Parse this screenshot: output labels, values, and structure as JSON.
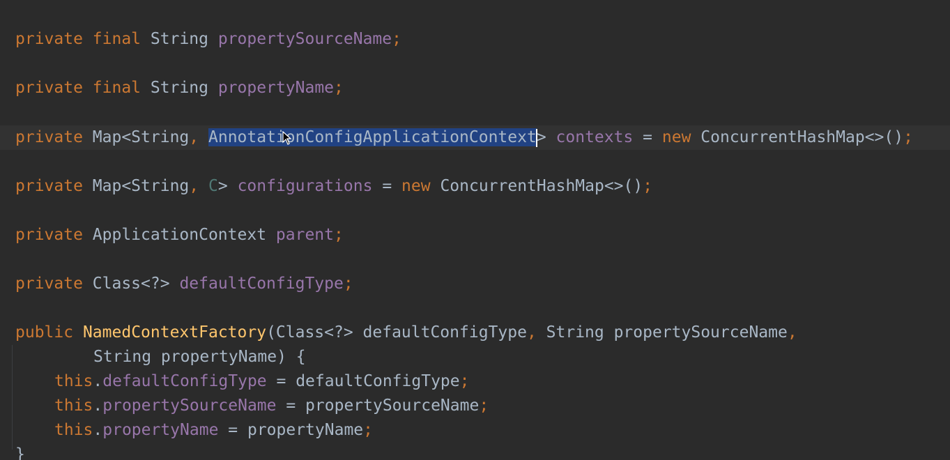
{
  "editor": {
    "lines": {
      "l1": {
        "kw1": "private",
        "kw2": "final",
        "type": "String",
        "name": "propertySourceName",
        "semi": ";"
      },
      "l2": {
        "kw1": "private",
        "kw2": "final",
        "type": "String",
        "name": "propertyName",
        "semi": ";"
      },
      "l3": {
        "kw1": "private",
        "type_a": "Map<String",
        "comma": ",",
        "selected": "AnnotationConfigApplicationContext",
        "close": ">",
        "name": "contexts",
        "eq": "=",
        "new_kw": "new",
        "ctor": "ConcurrentHashMap<>()",
        "semi": ";"
      },
      "l4": {
        "kw1": "private",
        "type_a": "Map<String",
        "comma": ",",
        "generic": "C",
        "close": ">",
        "name": "configurations",
        "eq": "=",
        "new_kw": "new",
        "ctor": "ConcurrentHashMap<>()",
        "semi": ";"
      },
      "l5": {
        "kw1": "private",
        "type": "ApplicationContext",
        "name": "parent",
        "semi": ";"
      },
      "l6": {
        "kw1": "private",
        "type": "Class<?>",
        "name": "defaultConfigType",
        "semi": ";"
      },
      "l7": {
        "kw1": "public",
        "method": "NamedContextFactory",
        "p1": "(Class<?> defaultConfigType",
        "comma1": ",",
        "p2": "String propertySourceName",
        "comma2": ","
      },
      "l8": {
        "p3": "String propertyName) {"
      },
      "l9": {
        "this_kw": "this",
        "dot": ".",
        "field": "defaultConfigType",
        "rest": "= defaultConfigType",
        "semi": ";"
      },
      "l10": {
        "this_kw": "this",
        "dot": ".",
        "field": "propertySourceName",
        "rest": "= propertySourceName",
        "semi": ";"
      },
      "l11": {
        "this_kw": "this",
        "dot": ".",
        "field": "propertyName",
        "rest": "= propertyName",
        "semi": ";"
      },
      "l12": {
        "brace": "}"
      }
    }
  },
  "colors": {
    "background": "#2b2b2b",
    "keyword": "#cc7832",
    "field": "#9876aa",
    "text": "#a9b7c6",
    "method": "#ffc66d",
    "selection": "#214283"
  },
  "icons": {
    "cursor": "mouse-pointer-icon"
  }
}
